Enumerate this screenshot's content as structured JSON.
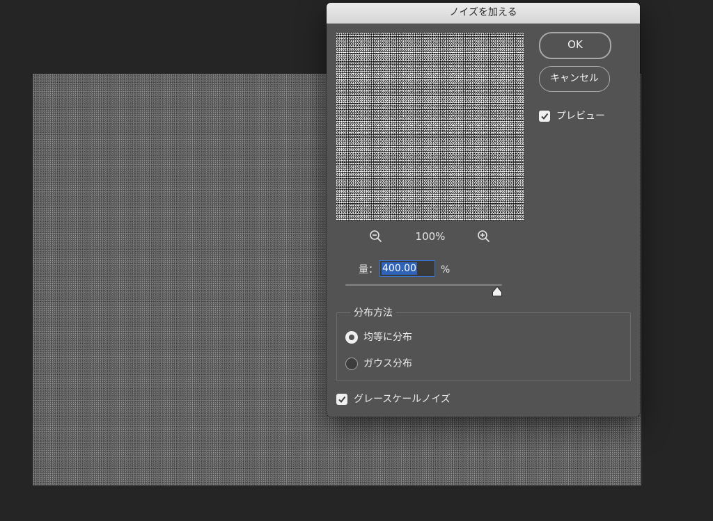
{
  "dialog": {
    "title": "ノイズを加える",
    "ok_label": "OK",
    "cancel_label": "キャンセル",
    "preview_checkbox": {
      "label": "プレビュー",
      "checked": true
    },
    "zoom": {
      "value": "100%"
    },
    "amount": {
      "label": "量：",
      "value": "400.00",
      "unit": "%",
      "slider_fraction": 0.97
    },
    "distribution": {
      "title": "分布方法",
      "options": [
        {
          "label": "均等に分布",
          "selected": true
        },
        {
          "label": "ガウス分布",
          "selected": false
        }
      ]
    },
    "monochrome_checkbox": {
      "label": "グレースケールノイズ",
      "checked": true
    }
  },
  "colors": {
    "workspace": "#252525",
    "dialog_bg": "#535353",
    "selection": "#2f63b8",
    "focus_border": "#3a72c6"
  },
  "icons": [
    "zoom-out-icon",
    "zoom-in-icon",
    "checkmark-icon",
    "slider-thumb-icon"
  ]
}
